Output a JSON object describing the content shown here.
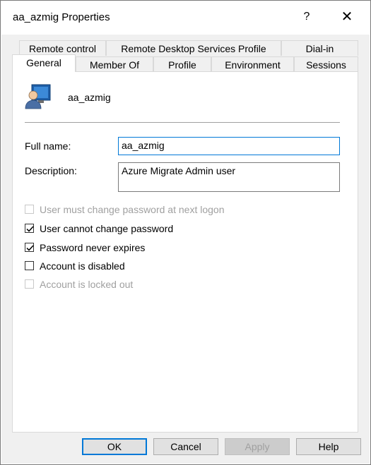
{
  "window": {
    "title": "aa_azmig Properties",
    "help_label": "?",
    "close_label": "✕"
  },
  "tabs": {
    "row1": [
      {
        "label": "Remote control"
      },
      {
        "label": "Remote Desktop Services Profile"
      },
      {
        "label": "Dial-in"
      }
    ],
    "row2": [
      {
        "label": "General",
        "active": true
      },
      {
        "label": "Member Of"
      },
      {
        "label": "Profile"
      },
      {
        "label": "Environment"
      },
      {
        "label": "Sessions"
      }
    ]
  },
  "general": {
    "user_icon": "user-icon",
    "username": "aa_azmig",
    "full_name_label": "Full name:",
    "full_name_value": "aa_azmig",
    "description_label": "Description:",
    "description_value": "Azure Migrate Admin user",
    "checkboxes": [
      {
        "label": "User must change password at next logon",
        "checked": false,
        "enabled": false
      },
      {
        "label": "User cannot change password",
        "checked": true,
        "enabled": true
      },
      {
        "label": "Password never expires",
        "checked": true,
        "enabled": true
      },
      {
        "label": "Account is disabled",
        "checked": false,
        "enabled": true
      },
      {
        "label": "Account is locked out",
        "checked": false,
        "enabled": false
      }
    ]
  },
  "buttons": {
    "ok": "OK",
    "cancel": "Cancel",
    "apply": "Apply",
    "help": "Help"
  },
  "colors": {
    "accent": "#0078d7",
    "disabled_text": "#a0a0a0"
  }
}
